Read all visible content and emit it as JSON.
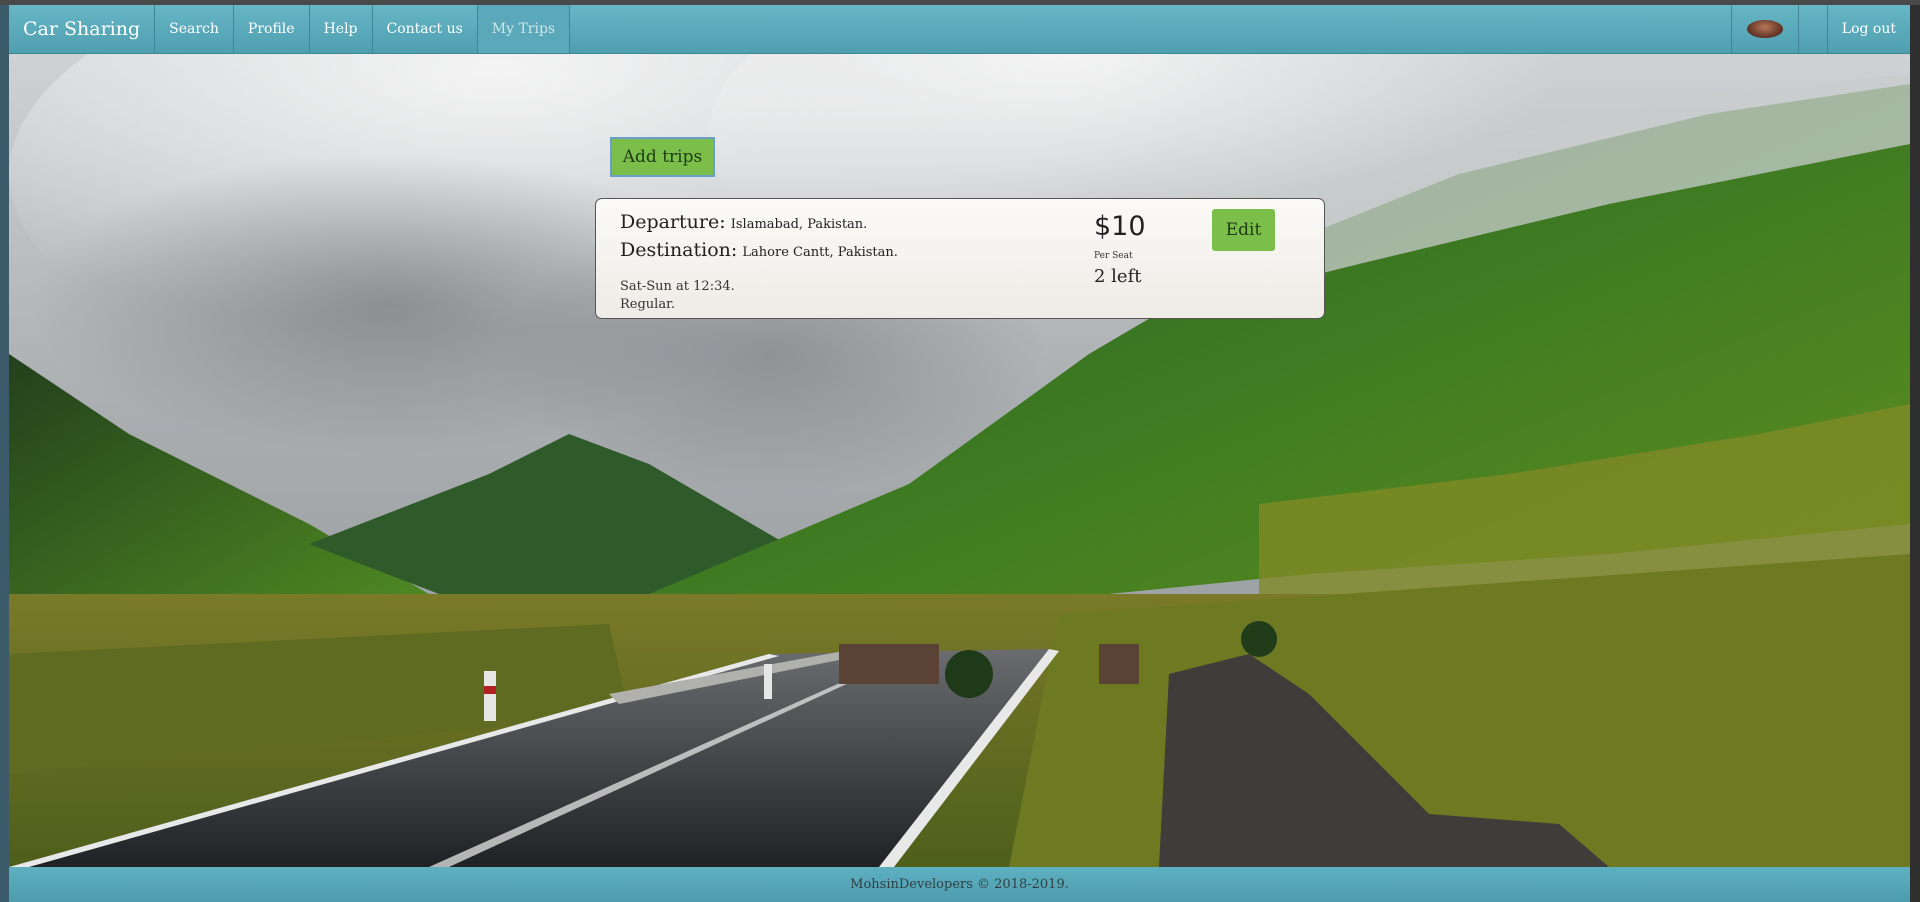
{
  "nav": {
    "brand": "Car Sharing",
    "links": [
      "Search",
      "Profile",
      "Help",
      "Contact us",
      "My Trips"
    ],
    "active": "My Trips",
    "logout": "Log out"
  },
  "actions": {
    "add_trips": "Add trips"
  },
  "trip": {
    "departure_label": "Departure:",
    "departure_value": "Islamabad, Pakistan.",
    "destination_label": "Destination:",
    "destination_value": "Lahore Cantt, Pakistan.",
    "schedule": "Sat-Sun at 12:34.",
    "type": "Regular.",
    "price": "$10",
    "price_unit": "Per Seat",
    "seats_left": "2 left",
    "edit": "Edit"
  },
  "footer": {
    "text": "MohsinDevelopers © 2018-2019."
  },
  "colors": {
    "navbar": "#5aa8b9",
    "button_green": "#7bbf4a"
  }
}
